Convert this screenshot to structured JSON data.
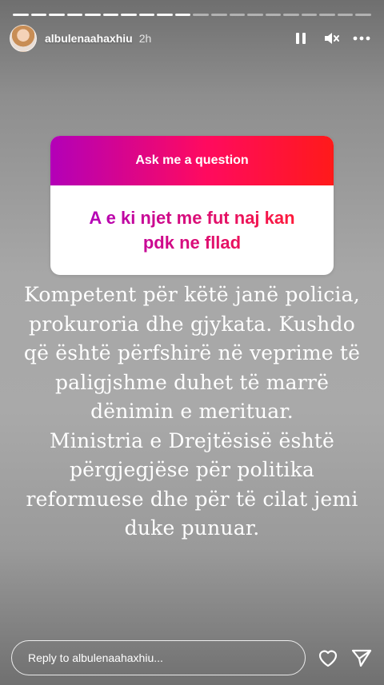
{
  "progress": {
    "segments": 20,
    "completed": 10
  },
  "header": {
    "username": "albulenaahaxhiu",
    "time": "2h"
  },
  "icons": {
    "pause": "pause-icon",
    "mute": "volume-muted-icon",
    "more": "more-icon",
    "heart": "heart-icon",
    "send": "send-icon"
  },
  "question_sticker": {
    "title": "Ask me a question",
    "answer": "A e ki njet me fut naj kan\npdk ne  fllad"
  },
  "caption": "Kompetent për këtë janë policia,\nprokuroria dhe gjykata. Kushdo\nqë është përfshirë në veprime të\npaligjshme duhet të marrë\ndënimin e merituar.\nMinistria e Drejtësisë është\npërgjegjëse për politika\nreformuese dhe për të cilat jemi\nduke punuar.",
  "footer": {
    "reply_placeholder": "Reply to albulenaahaxhiu..."
  }
}
